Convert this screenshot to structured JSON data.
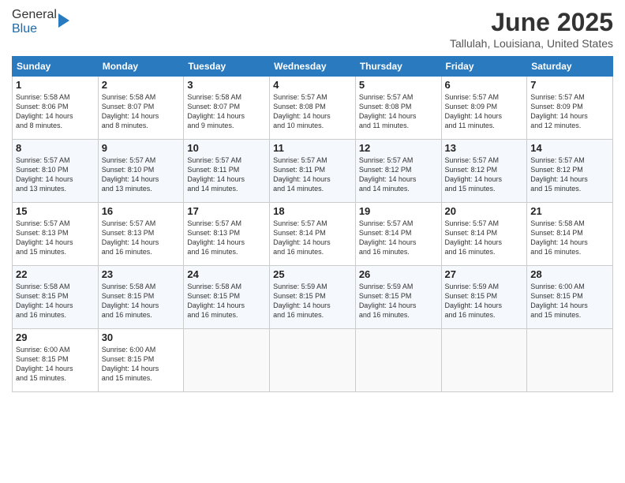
{
  "header": {
    "logo_general": "General",
    "logo_blue": "Blue",
    "month_title": "June 2025",
    "location": "Tallulah, Louisiana, United States"
  },
  "days_of_week": [
    "Sunday",
    "Monday",
    "Tuesday",
    "Wednesday",
    "Thursday",
    "Friday",
    "Saturday"
  ],
  "weeks": [
    [
      {
        "day": "1",
        "sunrise": "5:58 AM",
        "sunset": "8:06 PM",
        "daylight": "14 hours and 8 minutes."
      },
      {
        "day": "2",
        "sunrise": "5:58 AM",
        "sunset": "8:07 PM",
        "daylight": "14 hours and 8 minutes."
      },
      {
        "day": "3",
        "sunrise": "5:58 AM",
        "sunset": "8:07 PM",
        "daylight": "14 hours and 9 minutes."
      },
      {
        "day": "4",
        "sunrise": "5:57 AM",
        "sunset": "8:08 PM",
        "daylight": "14 hours and 10 minutes."
      },
      {
        "day": "5",
        "sunrise": "5:57 AM",
        "sunset": "8:08 PM",
        "daylight": "14 hours and 11 minutes."
      },
      {
        "day": "6",
        "sunrise": "5:57 AM",
        "sunset": "8:09 PM",
        "daylight": "14 hours and 11 minutes."
      },
      {
        "day": "7",
        "sunrise": "5:57 AM",
        "sunset": "8:09 PM",
        "daylight": "14 hours and 12 minutes."
      }
    ],
    [
      {
        "day": "8",
        "sunrise": "5:57 AM",
        "sunset": "8:10 PM",
        "daylight": "14 hours and 13 minutes."
      },
      {
        "day": "9",
        "sunrise": "5:57 AM",
        "sunset": "8:10 PM",
        "daylight": "14 hours and 13 minutes."
      },
      {
        "day": "10",
        "sunrise": "5:57 AM",
        "sunset": "8:11 PM",
        "daylight": "14 hours and 14 minutes."
      },
      {
        "day": "11",
        "sunrise": "5:57 AM",
        "sunset": "8:11 PM",
        "daylight": "14 hours and 14 minutes."
      },
      {
        "day": "12",
        "sunrise": "5:57 AM",
        "sunset": "8:12 PM",
        "daylight": "14 hours and 14 minutes."
      },
      {
        "day": "13",
        "sunrise": "5:57 AM",
        "sunset": "8:12 PM",
        "daylight": "14 hours and 15 minutes."
      },
      {
        "day": "14",
        "sunrise": "5:57 AM",
        "sunset": "8:12 PM",
        "daylight": "14 hours and 15 minutes."
      }
    ],
    [
      {
        "day": "15",
        "sunrise": "5:57 AM",
        "sunset": "8:13 PM",
        "daylight": "14 hours and 15 minutes."
      },
      {
        "day": "16",
        "sunrise": "5:57 AM",
        "sunset": "8:13 PM",
        "daylight": "14 hours and 16 minutes."
      },
      {
        "day": "17",
        "sunrise": "5:57 AM",
        "sunset": "8:13 PM",
        "daylight": "14 hours and 16 minutes."
      },
      {
        "day": "18",
        "sunrise": "5:57 AM",
        "sunset": "8:14 PM",
        "daylight": "14 hours and 16 minutes."
      },
      {
        "day": "19",
        "sunrise": "5:57 AM",
        "sunset": "8:14 PM",
        "daylight": "14 hours and 16 minutes."
      },
      {
        "day": "20",
        "sunrise": "5:57 AM",
        "sunset": "8:14 PM",
        "daylight": "14 hours and 16 minutes."
      },
      {
        "day": "21",
        "sunrise": "5:58 AM",
        "sunset": "8:14 PM",
        "daylight": "14 hours and 16 minutes."
      }
    ],
    [
      {
        "day": "22",
        "sunrise": "5:58 AM",
        "sunset": "8:15 PM",
        "daylight": "14 hours and 16 minutes."
      },
      {
        "day": "23",
        "sunrise": "5:58 AM",
        "sunset": "8:15 PM",
        "daylight": "14 hours and 16 minutes."
      },
      {
        "day": "24",
        "sunrise": "5:58 AM",
        "sunset": "8:15 PM",
        "daylight": "14 hours and 16 minutes."
      },
      {
        "day": "25",
        "sunrise": "5:59 AM",
        "sunset": "8:15 PM",
        "daylight": "14 hours and 16 minutes."
      },
      {
        "day": "26",
        "sunrise": "5:59 AM",
        "sunset": "8:15 PM",
        "daylight": "14 hours and 16 minutes."
      },
      {
        "day": "27",
        "sunrise": "5:59 AM",
        "sunset": "8:15 PM",
        "daylight": "14 hours and 16 minutes."
      },
      {
        "day": "28",
        "sunrise": "6:00 AM",
        "sunset": "8:15 PM",
        "daylight": "14 hours and 15 minutes."
      }
    ],
    [
      {
        "day": "29",
        "sunrise": "6:00 AM",
        "sunset": "8:15 PM",
        "daylight": "14 hours and 15 minutes."
      },
      {
        "day": "30",
        "sunrise": "6:00 AM",
        "sunset": "8:15 PM",
        "daylight": "14 hours and 15 minutes."
      },
      null,
      null,
      null,
      null,
      null
    ]
  ],
  "labels": {
    "sunrise": "Sunrise:",
    "sunset": "Sunset:",
    "daylight": "Daylight:"
  }
}
